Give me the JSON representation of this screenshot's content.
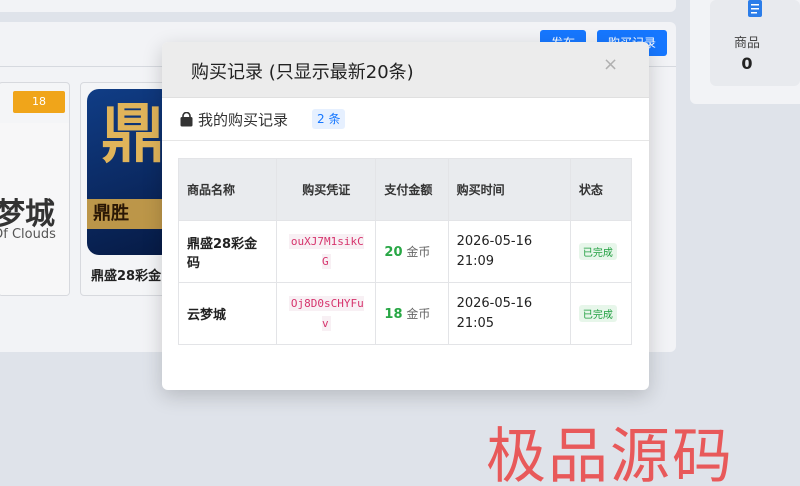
{
  "background": {
    "buttons": [
      "发布",
      "购买记录"
    ],
    "side_stat": {
      "label": "商品",
      "value": "0"
    },
    "product_1": {
      "tag": "18",
      "title": "梦城",
      "subtitle": "Of Clouds"
    },
    "product_2": {
      "image_text": "鼎",
      "image_strip": "鼎胜",
      "name": "鼎盛28彩金"
    }
  },
  "modal": {
    "title": "购买记录 (只显示最新20条)",
    "close": "×",
    "subheader_label": "我的购买记录",
    "count_badge": "2 条",
    "columns": [
      "商品名称",
      "购买凭证",
      "支付金额",
      "购买时间",
      "状态"
    ],
    "rows": [
      {
        "name": "鼎盛28彩金码",
        "voucher": "ouXJ7M1sikCG",
        "amount": "20",
        "unit": "金币",
        "time": "2026-05-16 21:09",
        "status": "已完成"
      },
      {
        "name": "云梦城",
        "voucher": "Oj8D0sCHYFuv",
        "amount": "18",
        "unit": "金币",
        "time": "2026-05-16 21:05",
        "status": "已完成"
      }
    ]
  },
  "watermark": "极品源码",
  "colors": {
    "accent": "#1677ff",
    "success": "#28a745",
    "voucher": "#d6336c",
    "tag": "#f0a51a",
    "watermark": "#ea4b4b"
  }
}
